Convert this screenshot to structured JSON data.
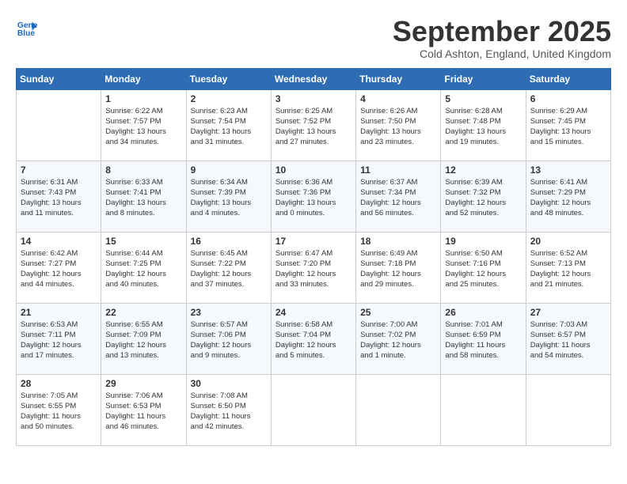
{
  "header": {
    "logo_line1": "General",
    "logo_line2": "Blue",
    "month": "September 2025",
    "location": "Cold Ashton, England, United Kingdom"
  },
  "days_of_week": [
    "Sunday",
    "Monday",
    "Tuesday",
    "Wednesday",
    "Thursday",
    "Friday",
    "Saturday"
  ],
  "weeks": [
    [
      {
        "day": "",
        "content": ""
      },
      {
        "day": "1",
        "content": "Sunrise: 6:22 AM\nSunset: 7:57 PM\nDaylight: 13 hours\nand 34 minutes."
      },
      {
        "day": "2",
        "content": "Sunrise: 6:23 AM\nSunset: 7:54 PM\nDaylight: 13 hours\nand 31 minutes."
      },
      {
        "day": "3",
        "content": "Sunrise: 6:25 AM\nSunset: 7:52 PM\nDaylight: 13 hours\nand 27 minutes."
      },
      {
        "day": "4",
        "content": "Sunrise: 6:26 AM\nSunset: 7:50 PM\nDaylight: 13 hours\nand 23 minutes."
      },
      {
        "day": "5",
        "content": "Sunrise: 6:28 AM\nSunset: 7:48 PM\nDaylight: 13 hours\nand 19 minutes."
      },
      {
        "day": "6",
        "content": "Sunrise: 6:29 AM\nSunset: 7:45 PM\nDaylight: 13 hours\nand 15 minutes."
      }
    ],
    [
      {
        "day": "7",
        "content": "Sunrise: 6:31 AM\nSunset: 7:43 PM\nDaylight: 13 hours\nand 11 minutes."
      },
      {
        "day": "8",
        "content": "Sunrise: 6:33 AM\nSunset: 7:41 PM\nDaylight: 13 hours\nand 8 minutes."
      },
      {
        "day": "9",
        "content": "Sunrise: 6:34 AM\nSunset: 7:39 PM\nDaylight: 13 hours\nand 4 minutes."
      },
      {
        "day": "10",
        "content": "Sunrise: 6:36 AM\nSunset: 7:36 PM\nDaylight: 13 hours\nand 0 minutes."
      },
      {
        "day": "11",
        "content": "Sunrise: 6:37 AM\nSunset: 7:34 PM\nDaylight: 12 hours\nand 56 minutes."
      },
      {
        "day": "12",
        "content": "Sunrise: 6:39 AM\nSunset: 7:32 PM\nDaylight: 12 hours\nand 52 minutes."
      },
      {
        "day": "13",
        "content": "Sunrise: 6:41 AM\nSunset: 7:29 PM\nDaylight: 12 hours\nand 48 minutes."
      }
    ],
    [
      {
        "day": "14",
        "content": "Sunrise: 6:42 AM\nSunset: 7:27 PM\nDaylight: 12 hours\nand 44 minutes."
      },
      {
        "day": "15",
        "content": "Sunrise: 6:44 AM\nSunset: 7:25 PM\nDaylight: 12 hours\nand 40 minutes."
      },
      {
        "day": "16",
        "content": "Sunrise: 6:45 AM\nSunset: 7:22 PM\nDaylight: 12 hours\nand 37 minutes."
      },
      {
        "day": "17",
        "content": "Sunrise: 6:47 AM\nSunset: 7:20 PM\nDaylight: 12 hours\nand 33 minutes."
      },
      {
        "day": "18",
        "content": "Sunrise: 6:49 AM\nSunset: 7:18 PM\nDaylight: 12 hours\nand 29 minutes."
      },
      {
        "day": "19",
        "content": "Sunrise: 6:50 AM\nSunset: 7:16 PM\nDaylight: 12 hours\nand 25 minutes."
      },
      {
        "day": "20",
        "content": "Sunrise: 6:52 AM\nSunset: 7:13 PM\nDaylight: 12 hours\nand 21 minutes."
      }
    ],
    [
      {
        "day": "21",
        "content": "Sunrise: 6:53 AM\nSunset: 7:11 PM\nDaylight: 12 hours\nand 17 minutes."
      },
      {
        "day": "22",
        "content": "Sunrise: 6:55 AM\nSunset: 7:09 PM\nDaylight: 12 hours\nand 13 minutes."
      },
      {
        "day": "23",
        "content": "Sunrise: 6:57 AM\nSunset: 7:06 PM\nDaylight: 12 hours\nand 9 minutes."
      },
      {
        "day": "24",
        "content": "Sunrise: 6:58 AM\nSunset: 7:04 PM\nDaylight: 12 hours\nand 5 minutes."
      },
      {
        "day": "25",
        "content": "Sunrise: 7:00 AM\nSunset: 7:02 PM\nDaylight: 12 hours\nand 1 minute."
      },
      {
        "day": "26",
        "content": "Sunrise: 7:01 AM\nSunset: 6:59 PM\nDaylight: 11 hours\nand 58 minutes."
      },
      {
        "day": "27",
        "content": "Sunrise: 7:03 AM\nSunset: 6:57 PM\nDaylight: 11 hours\nand 54 minutes."
      }
    ],
    [
      {
        "day": "28",
        "content": "Sunrise: 7:05 AM\nSunset: 6:55 PM\nDaylight: 11 hours\nand 50 minutes."
      },
      {
        "day": "29",
        "content": "Sunrise: 7:06 AM\nSunset: 6:53 PM\nDaylight: 11 hours\nand 46 minutes."
      },
      {
        "day": "30",
        "content": "Sunrise: 7:08 AM\nSunset: 6:50 PM\nDaylight: 11 hours\nand 42 minutes."
      },
      {
        "day": "",
        "content": ""
      },
      {
        "day": "",
        "content": ""
      },
      {
        "day": "",
        "content": ""
      },
      {
        "day": "",
        "content": ""
      }
    ]
  ]
}
